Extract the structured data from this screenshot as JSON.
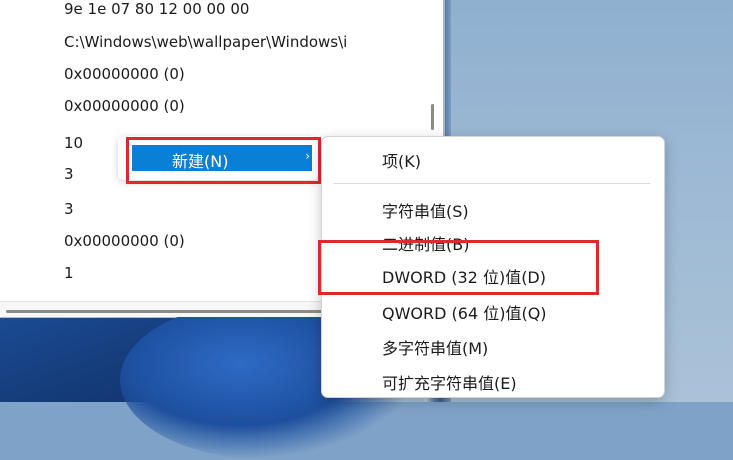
{
  "registry_values": [
    "9e 1e 07 80 12 00 00 00",
    "C:\\Windows\\web\\wallpaper\\Windows\\i",
    "0x00000000 (0)",
    "0x00000000 (0)",
    "10",
    "3",
    "3",
    "0x00000000 (0)",
    "1"
  ],
  "context_menu": {
    "new_label": "新建(N)",
    "arrow": "›"
  },
  "submenu": {
    "key": "项(K)",
    "string_value": "字符串值(S)",
    "binary_value": "二进制值(B)",
    "dword_value": "DWORD (32 位)值(D)",
    "qword_value": "QWORD (64 位)值(Q)",
    "multi_string_value": "多字符串值(M)",
    "expandable_string_value": "可扩充字符串值(E)"
  },
  "colors": {
    "highlight": "#0a7fd6",
    "annotation": "#e02929"
  }
}
